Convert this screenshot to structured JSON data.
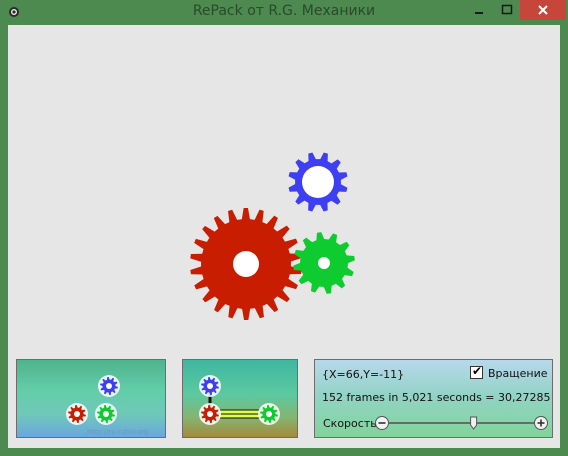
{
  "window": {
    "title": "RePack от R.G. Механики",
    "bg_color": "#4d8a4f"
  },
  "gears": {
    "colors": {
      "red": "#c81d00",
      "blue": "#3e3ef2",
      "green": "#0ecc2f"
    },
    "red": {
      "teeth": 22
    },
    "blue": {
      "teeth": 12
    },
    "green": {
      "teeth": 12
    }
  },
  "info": {
    "coords": "{X=66,Y=-11}",
    "fps": "152 frames in 5,021 seconds = 30,27285 FPS",
    "rotation_label": "Вращение",
    "rotation_checked": true,
    "check_mark": "✔",
    "speed_label": "Скорость",
    "speed_value": 0.58
  },
  "thumbnail": {
    "watermark": "http://ru.rutor.org"
  }
}
